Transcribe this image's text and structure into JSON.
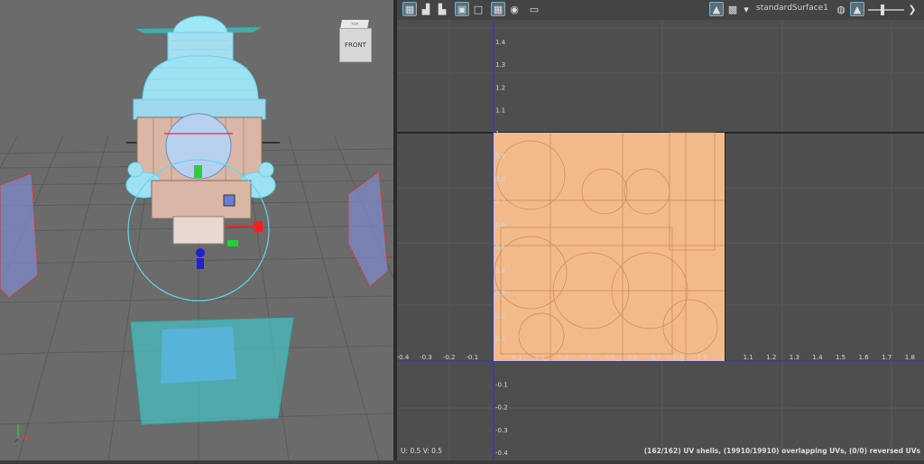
{
  "viewport3d": {
    "viewcube_top": "TOP",
    "viewcube_face": "FRONT",
    "axis_labels": {
      "x": "x",
      "y": "y",
      "z": "z"
    }
  },
  "uv_editor": {
    "shader_name": "standardSurface1",
    "x_ticks": [
      "-0.4",
      "-0.3",
      "-0.2",
      "-0.1",
      "0.1",
      "0.2",
      "0.3",
      "0.4",
      "0.5",
      "0.6",
      "0.7",
      "0.8",
      "0.9",
      "1",
      "1.1",
      "1.2",
      "1.3",
      "1.4",
      "1.5",
      "1.6",
      "1.7",
      "1.8"
    ],
    "y_ticks": [
      "1.4",
      "1.3",
      "1.2",
      "1.1",
      "1",
      "0.9",
      "0.8",
      "0.7",
      "0.6",
      "0.5",
      "0.4",
      "0.3",
      "0.2",
      "0.1",
      "-0.1",
      "-0.2",
      "-0.3",
      "-0.4"
    ],
    "status_left": "U:  0.5 V:  0.5",
    "status_right": "(162/162) UV shells, (19910/19910) overlapping UVs, (0/0) reversed UVs"
  },
  "colors": {
    "uv_fill": "#f2b98a",
    "wire_cyan": "#5fd8f0",
    "body_pink": "#d9b6a6",
    "plane_blue": "#7d88c8",
    "ground_cyan": "#46c3c6"
  }
}
